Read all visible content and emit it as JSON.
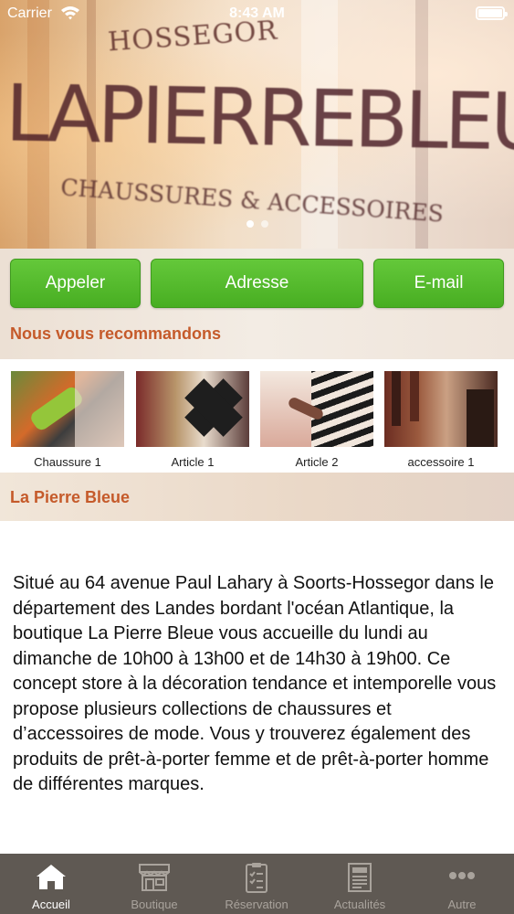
{
  "status_bar": {
    "carrier": "Carrier",
    "time": "8:43 AM",
    "wifi_icon": "wifi-icon",
    "battery_icon": "battery-icon"
  },
  "hero": {
    "image_text_top": "HOSSEGOR",
    "image_text_main": "LAPIERREBLEUE",
    "image_text_sub": "CHAUSSURES & ACCESSOIRES",
    "carousel_pages": 2,
    "carousel_active_index": 0
  },
  "actions": {
    "call_label": "Appeler",
    "address_label": "Adresse",
    "email_label": "E-mail",
    "button_color": "#52b92a"
  },
  "recommend": {
    "title": "Nous vous recommandons",
    "items": [
      {
        "label": "Chaussure 1"
      },
      {
        "label": "Article 1"
      },
      {
        "label": "Article 2"
      },
      {
        "label": "accessoire 1"
      }
    ]
  },
  "about": {
    "title": "La Pierre Bleue",
    "description": "Situé au 64 avenue Paul Lahary à Soorts-Hossegor dans le département des Landes bordant l'océan Atlantique, la boutique La Pierre Bleue vous accueille du lundi au dimanche de 10h00 à 13h00 et de 14h30 à 19h00. Ce concept store à la décoration tendance et intemporelle vous propose plusieurs collections de chaussures et d’accessoires de mode. Vous y trouverez également des produits de prêt-à-porter femme et de prêt-à-porter homme de différentes marques."
  },
  "tabbar": {
    "tabs": [
      {
        "label": "Accueil",
        "icon": "home-icon",
        "active": true
      },
      {
        "label": "Boutique",
        "icon": "shop-icon",
        "active": false
      },
      {
        "label": "Réservation",
        "icon": "clipboard-icon",
        "active": false
      },
      {
        "label": "Actualités",
        "icon": "newspaper-icon",
        "active": false
      },
      {
        "label": "Autre",
        "icon": "more-icon",
        "active": false
      }
    ]
  },
  "colors": {
    "accent_title": "#c55a2a",
    "tabbar_bg": "#5f5953"
  }
}
